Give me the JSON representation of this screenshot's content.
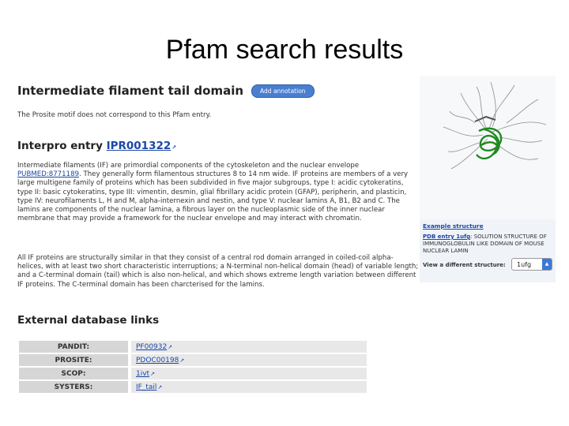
{
  "slide": {
    "title": "Pfam search results"
  },
  "domain": {
    "title": "Intermediate filament tail domain",
    "add_annotation": "Add annotation",
    "prosite_note": "The Prosite motif does not correspond to this Pfam entry."
  },
  "interpro": {
    "label": "Interpro entry",
    "id": "IPR001322",
    "para1_start": "Intermediate filaments (IF) are primordial components of the cytoskeleton and the nuclear envelope",
    "pubmed": "PUBMED:8771189",
    "para1_rest": ". They generally form filamentous structures 8 to 14 nm wide. IF proteins are members of a very large multigene family of proteins which has been subdivided in five major subgroups, type I: acidic cytokeratins, type II: basic cytokeratins, type III: vimentin, desmin, glial fibrillary acidic protein (GFAP), peripherin, and plasticin, type IV: neurofilaments L, H and M, alpha-internexin and nestin, and type V: nuclear lamins A, B1, B2 and C. The lamins are components of the nuclear lamina, a fibrous layer on the nucleoplasmic side of the inner nuclear membrane that may provide a framework for the nuclear envelope and may interact with chromatin.",
    "para2": "All IF proteins are structurally similar in that they consist of a central rod domain arranged in coiled-coil alpha-helices, with at least two short characteristic interruptions; a N-terminal non-helical domain (head) of variable length; and a C-terminal domain (tail) which is also non-helical, and which shows extreme length variation between different IF proteins. The C-terminal domain has been charcterised for the lamins."
  },
  "structure": {
    "example_label": "Example structure",
    "pdb_link": "PDB entry 1ufg",
    "pdb_desc": ": SOLUTION STRUCTURE OF IMMUNOGLOBULIN LIKE DOMAIN OF MOUSE NUCLEAR LAMIN",
    "view_label": "View a different structure:",
    "selected": "1ufg"
  },
  "external": {
    "title": "External database links",
    "rows": [
      {
        "db": "PANDIT:",
        "value": "PF00932"
      },
      {
        "db": "PROSITE:",
        "value": "PDOC00198"
      },
      {
        "db": "SCOP:",
        "value": "1ivt"
      },
      {
        "db": "SYSTERS:",
        "value": "IF_tail"
      }
    ]
  },
  "colors": {
    "link": "#1b47a6",
    "button": "#4a7ed0",
    "protein": "#1f8a1f"
  },
  "icons": {
    "external": "external-link-icon",
    "dropdown": "dropdown-arrow-icon"
  }
}
